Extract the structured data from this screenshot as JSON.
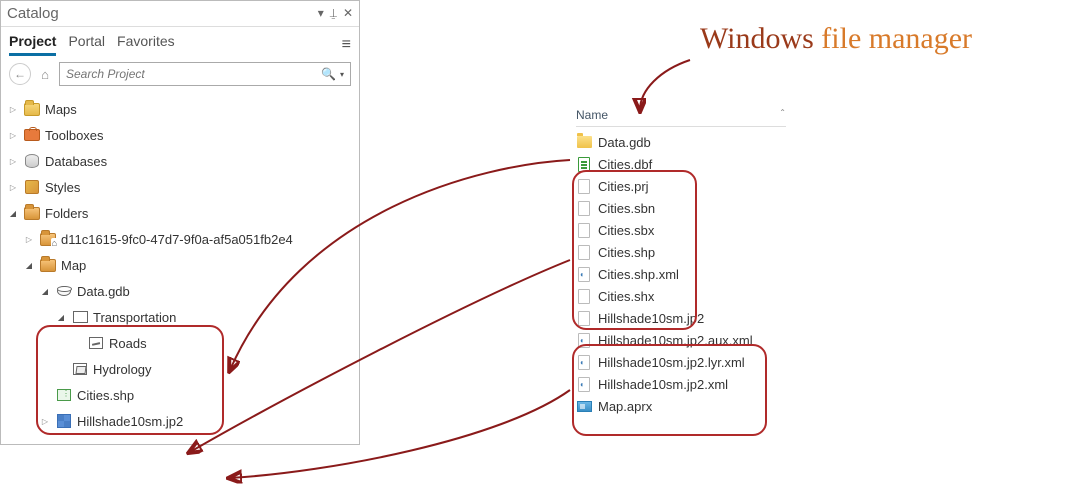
{
  "panel": {
    "title": "Catalog"
  },
  "tabs": {
    "project": "Project",
    "portal": "Portal",
    "favorites": "Favorites"
  },
  "search": {
    "placeholder": "Search Project"
  },
  "tree": {
    "maps": "Maps",
    "toolboxes": "Toolboxes",
    "databases": "Databases",
    "styles": "Styles",
    "folders": "Folders",
    "guid_folder": "d11c1615-9fc0-47d7-9f0a-af5a051fb2e4",
    "map_folder": "Map",
    "gdb": "Data.gdb",
    "transportation": "Transportation",
    "roads": "Roads",
    "hydrology": "Hydrology",
    "cities": "Cities.shp",
    "hillshade": "Hillshade10sm.jp2"
  },
  "fm": {
    "header": "Name",
    "items": [
      "Data.gdb",
      "Cities.dbf",
      "Cities.prj",
      "Cities.sbn",
      "Cities.sbx",
      "Cities.shp",
      "Cities.shp.xml",
      "Cities.shx",
      "Hillshade10sm.jp2",
      "Hillshade10sm.jp2.aux.xml",
      "Hillshade10sm.jp2.lyr.xml",
      "Hillshade10sm.jp2.xml",
      "Map.aprx"
    ]
  },
  "annotation": {
    "w1": "Windows",
    "w2": "file manager"
  }
}
